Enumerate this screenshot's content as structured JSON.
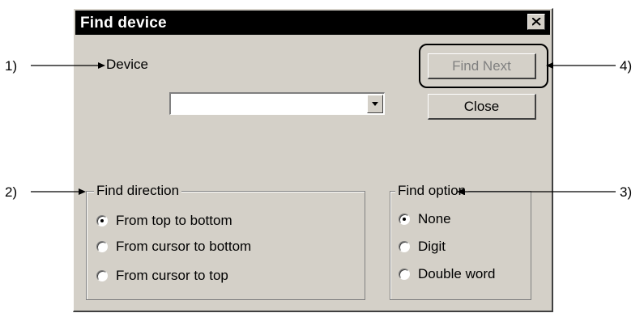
{
  "dialog": {
    "title": "Find device",
    "device_label": "Device",
    "device_value": "",
    "find_next_label": "Find Next",
    "close_label": "Close",
    "find_direction": {
      "title": "Find direction",
      "options": [
        "From top to bottom",
        "From cursor to bottom",
        "From cursor to top"
      ],
      "selected": "From top to bottom"
    },
    "find_option": {
      "title": "Find option",
      "options": [
        "None",
        "Digit",
        "Double word"
      ],
      "selected": "None"
    }
  },
  "callouts": [
    "1)",
    "2)",
    "3)",
    "4)"
  ],
  "colors": {
    "face": "#d4d0c8",
    "titlebar": "#000000",
    "disabled_text": "#808080"
  }
}
